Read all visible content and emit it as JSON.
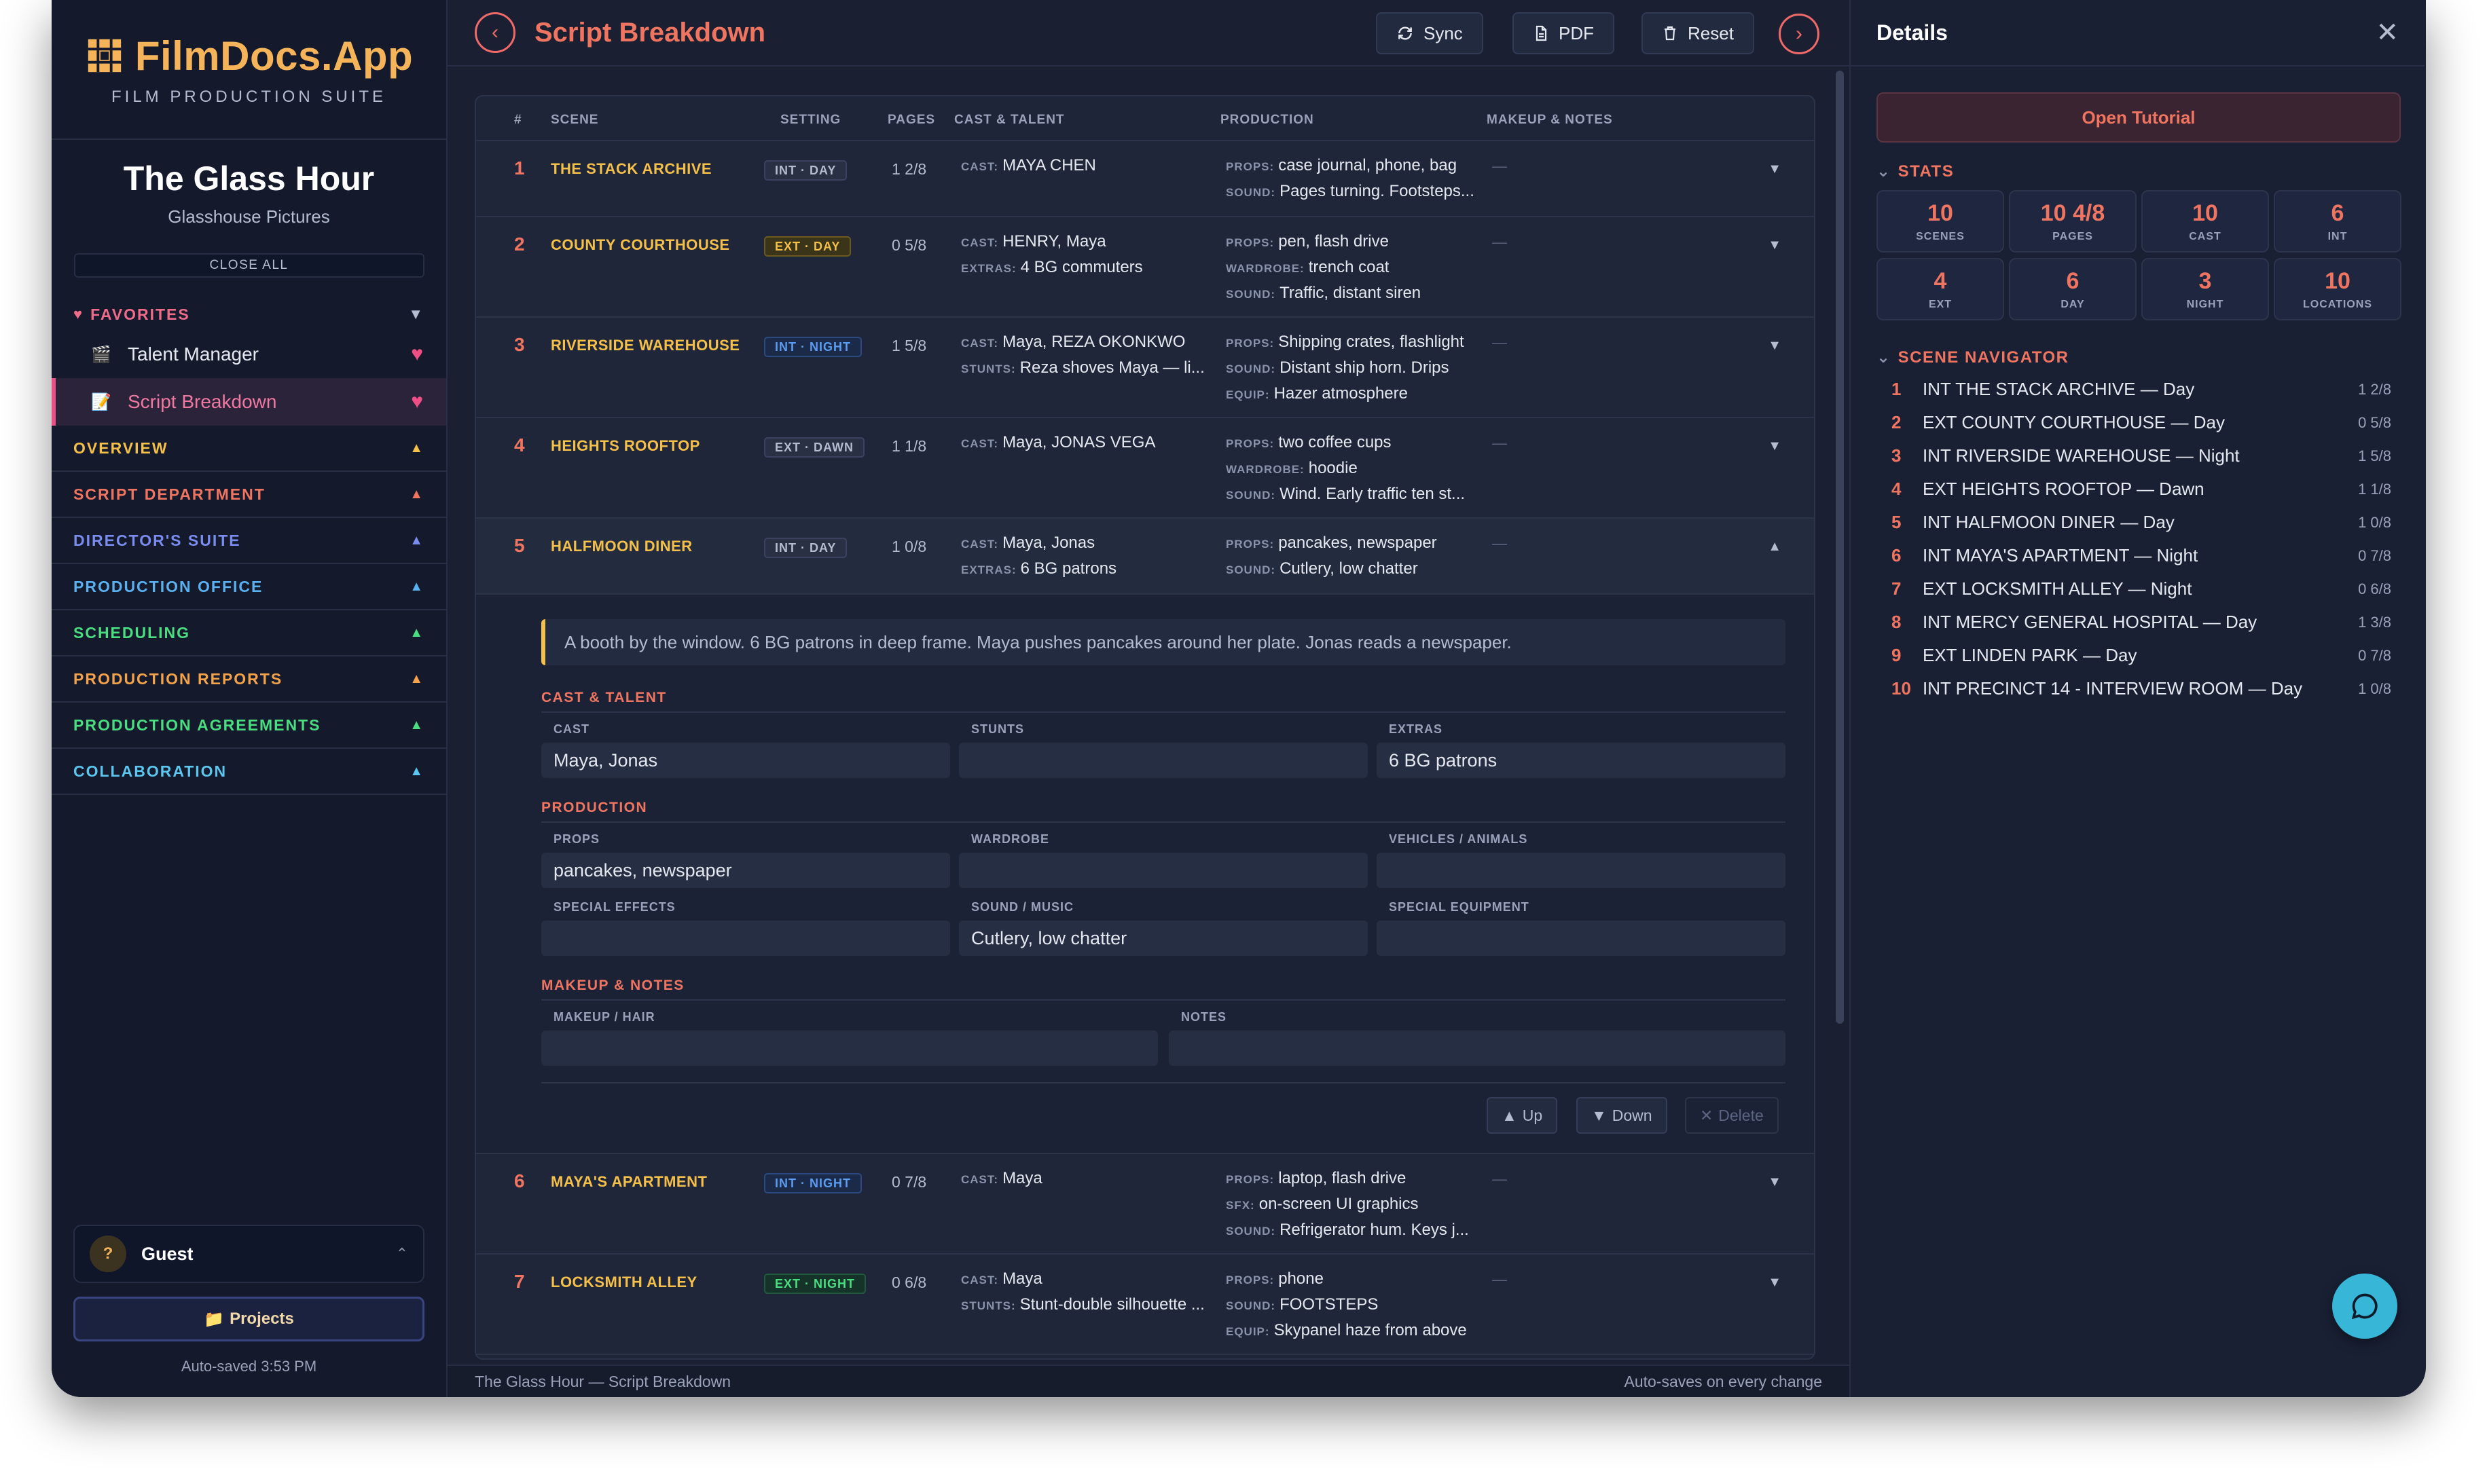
{
  "app": {
    "name": "FilmDocs.App",
    "tagline": "FILM PRODUCTION SUITE"
  },
  "project": {
    "title": "The Glass Hour",
    "company": "Glasshouse Pictures"
  },
  "sidebar": {
    "close_all": "CLOSE ALL",
    "favorites_label": "FAVORITES",
    "favorites": [
      {
        "label": "Talent Manager",
        "icon": "film-icon"
      },
      {
        "label": "Script Breakdown",
        "icon": "script-icon"
      }
    ],
    "sections": [
      {
        "label": "OVERVIEW",
        "color": "#f5c04a"
      },
      {
        "label": "SCRIPT DEPARTMENT",
        "color": "#f07561"
      },
      {
        "label": "DIRECTOR'S SUITE",
        "color": "#7a8cf0"
      },
      {
        "label": "PRODUCTION OFFICE",
        "color": "#5bb0f0"
      },
      {
        "label": "SCHEDULING",
        "color": "#4ade80"
      },
      {
        "label": "PRODUCTION REPORTS",
        "color": "#f5a34a"
      },
      {
        "label": "PRODUCTION AGREEMENTS",
        "color": "#4ade80"
      },
      {
        "label": "COLLABORATION",
        "color": "#5bc6f0"
      }
    ],
    "user": {
      "initial": "?",
      "name": "Guest"
    },
    "projects_label": "Projects",
    "autosaved": "Auto-saved 3:53 PM"
  },
  "toolbar": {
    "title": "Script Breakdown",
    "sync": "Sync",
    "pdf": "PDF",
    "reset": "Reset"
  },
  "table": {
    "headers": [
      "#",
      "SCENE",
      "SETTING",
      "PAGES",
      "CAST & TALENT",
      "PRODUCTION",
      "MAKEUP & NOTES"
    ],
    "rows": [
      {
        "num": "1",
        "scene": "THE STACK ARCHIVE",
        "setting": "INT · DAY",
        "badge": "int-day",
        "pages": "1 2/8",
        "cast": [
          {
            "label": "CAST:",
            "value": "MAYA CHEN"
          }
        ],
        "prod": [
          {
            "label": "PROPS:",
            "value": "case journal, phone, bag"
          },
          {
            "label": "SOUND:",
            "value": "Pages turning. Footsteps..."
          }
        ],
        "mk": "—"
      },
      {
        "num": "2",
        "scene": "COUNTY COURTHOUSE",
        "setting": "EXT · DAY",
        "badge": "ext-day",
        "pages": "0 5/8",
        "cast": [
          {
            "label": "CAST:",
            "value": "HENRY, Maya"
          },
          {
            "label": "EXTRAS:",
            "value": "4 BG commuters"
          }
        ],
        "prod": [
          {
            "label": "PROPS:",
            "value": "pen, flash drive"
          },
          {
            "label": "WARDROBE:",
            "value": "trench coat"
          },
          {
            "label": "SOUND:",
            "value": "Traffic, distant siren"
          }
        ],
        "mk": "—"
      },
      {
        "num": "3",
        "scene": "RIVERSIDE WAREHOUSE",
        "setting": "INT · NIGHT",
        "badge": "int-night",
        "pages": "1 5/8",
        "cast": [
          {
            "label": "CAST:",
            "value": "Maya, REZA OKONKWO"
          },
          {
            "label": "STUNTS:",
            "value": "Reza shoves Maya — li..."
          }
        ],
        "prod": [
          {
            "label": "PROPS:",
            "value": "Shipping crates, flashlight"
          },
          {
            "label": "SOUND:",
            "value": "Distant ship horn. Drips"
          },
          {
            "label": "EQUIP:",
            "value": "Hazer atmosphere"
          }
        ],
        "mk": "—"
      },
      {
        "num": "4",
        "scene": "HEIGHTS ROOFTOP",
        "setting": "EXT · DAWN",
        "badge": "ext-dawn",
        "pages": "1 1/8",
        "cast": [
          {
            "label": "CAST:",
            "value": "Maya, JONAS VEGA"
          }
        ],
        "prod": [
          {
            "label": "PROPS:",
            "value": "two coffee cups"
          },
          {
            "label": "WARDROBE:",
            "value": "hoodie"
          },
          {
            "label": "SOUND:",
            "value": "Wind. Early traffic ten st..."
          }
        ],
        "mk": "—"
      },
      {
        "num": "5",
        "scene": "HALFMOON DINER",
        "setting": "INT · DAY",
        "badge": "int-day",
        "pages": "1 0/8",
        "cast": [
          {
            "label": "CAST:",
            "value": "Maya, Jonas"
          },
          {
            "label": "EXTRAS:",
            "value": "6 BG patrons"
          }
        ],
        "prod": [
          {
            "label": "PROPS:",
            "value": "pancakes, newspaper"
          },
          {
            "label": "SOUND:",
            "value": "Cutlery, low chatter"
          }
        ],
        "mk": "—"
      },
      {
        "num": "6",
        "scene": "MAYA'S APARTMENT",
        "setting": "INT · NIGHT",
        "badge": "int-night",
        "pages": "0 7/8",
        "cast": [
          {
            "label": "CAST:",
            "value": "Maya"
          }
        ],
        "prod": [
          {
            "label": "PROPS:",
            "value": "laptop, flash drive"
          },
          {
            "label": "SFX:",
            "value": "on-screen UI graphics"
          },
          {
            "label": "SOUND:",
            "value": "Refrigerator hum. Keys j..."
          }
        ],
        "mk": "—"
      },
      {
        "num": "7",
        "scene": "LOCKSMITH ALLEY",
        "setting": "EXT · NIGHT",
        "badge": "ext-night",
        "pages": "0 6/8",
        "cast": [
          {
            "label": "CAST:",
            "value": "Maya"
          },
          {
            "label": "STUNTS:",
            "value": "Stunt-double silhouette ..."
          }
        ],
        "prod": [
          {
            "label": "PROPS:",
            "value": "phone"
          },
          {
            "label": "SOUND:",
            "value": "FOOTSTEPS"
          },
          {
            "label": "EQUIP:",
            "value": "Skypanel haze from above"
          }
        ],
        "mk": "—"
      }
    ]
  },
  "expanded": {
    "description": "A booth by the window. 6 BG patrons in deep frame. Maya pushes pancakes around her plate. Jonas reads a newspaper.",
    "cast_section": "CAST & TALENT",
    "cast_label": "CAST",
    "cast_value": "Maya, Jonas",
    "stunts_label": "STUNTS",
    "stunts_value": "",
    "extras_label": "EXTRAS",
    "extras_value": "6 BG patrons",
    "production_section": "PRODUCTION",
    "props_label": "PROPS",
    "props_value": "pancakes, newspaper",
    "wardrobe_label": "WARDROBE",
    "wardrobe_value": "",
    "vehicles_label": "VEHICLES / ANIMALS",
    "vehicles_value": "",
    "sfx_label": "SPECIAL EFFECTS",
    "sfx_value": "",
    "sound_label": "SOUND / MUSIC",
    "sound_value": "Cutlery, low chatter",
    "equip_label": "SPECIAL EQUIPMENT",
    "equip_value": "",
    "makeup_section": "MAKEUP & NOTES",
    "makeup_label": "MAKEUP / HAIR",
    "makeup_value": "",
    "notes_label": "NOTES",
    "notes_value": "",
    "up": "Up",
    "down": "Down",
    "delete": "Delete"
  },
  "footer": {
    "left": "The Glass Hour — Script Breakdown",
    "right": "Auto-saves on every change"
  },
  "details": {
    "title": "Details",
    "tutorial": "Open Tutorial",
    "stats_label": "STATS",
    "stats": [
      {
        "value": "10",
        "label": "SCENES"
      },
      {
        "value": "10 4/8",
        "label": "PAGES"
      },
      {
        "value": "10",
        "label": "CAST"
      },
      {
        "value": "6",
        "label": "INT"
      },
      {
        "value": "4",
        "label": "EXT"
      },
      {
        "value": "6",
        "label": "DAY"
      },
      {
        "value": "3",
        "label": "NIGHT"
      },
      {
        "value": "10",
        "label": "LOCATIONS"
      }
    ],
    "navigator_label": "SCENE NAVIGATOR",
    "navigator": [
      {
        "num": "1",
        "title": "INT THE STACK ARCHIVE — Day",
        "pages": "1 2/8"
      },
      {
        "num": "2",
        "title": "EXT COUNTY COURTHOUSE — Day",
        "pages": "0 5/8"
      },
      {
        "num": "3",
        "title": "INT RIVERSIDE WAREHOUSE — Night",
        "pages": "1 5/8"
      },
      {
        "num": "4",
        "title": "EXT HEIGHTS ROOFTOP — Dawn",
        "pages": "1 1/8"
      },
      {
        "num": "5",
        "title": "INT HALFMOON DINER — Day",
        "pages": "1 0/8"
      },
      {
        "num": "6",
        "title": "INT MAYA'S APARTMENT — Night",
        "pages": "0 7/8"
      },
      {
        "num": "7",
        "title": "EXT LOCKSMITH ALLEY — Night",
        "pages": "0 6/8"
      },
      {
        "num": "8",
        "title": "INT MERCY GENERAL HOSPITAL — Day",
        "pages": "1 3/8"
      },
      {
        "num": "9",
        "title": "EXT LINDEN PARK — Day",
        "pages": "0 7/8"
      },
      {
        "num": "10",
        "title": "INT PRECINCT 14 - INTERVIEW ROOM — Day",
        "pages": "1 0/8"
      }
    ]
  },
  "colors": {
    "accent": "#f07561",
    "brand": "#f5b35a",
    "scene": "#f5c04a",
    "favorite": "#ec4f86",
    "chat": "#38b6d8"
  }
}
